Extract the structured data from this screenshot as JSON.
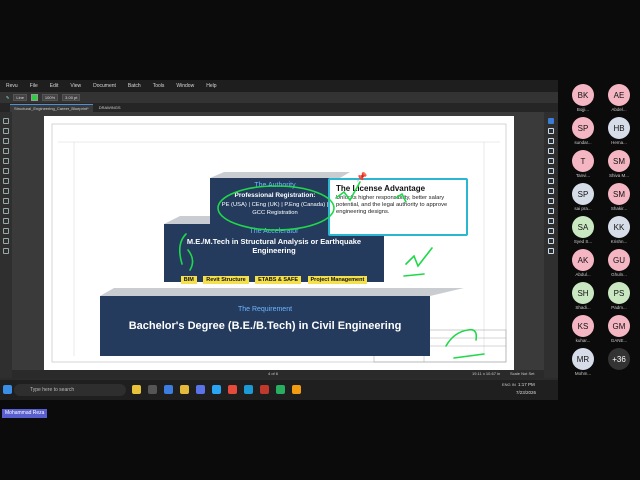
{
  "menu": [
    "Revu",
    "File",
    "Edit",
    "View",
    "Document",
    "Batch",
    "Tools",
    "Window",
    "Help"
  ],
  "toolbar": {
    "line_label": "Line",
    "zoom": "100%",
    "thickness": "3.00 pt"
  },
  "tabs": {
    "file": "Structural_Engineering_Career_Blueprint*",
    "drawings": "DRAWINGS"
  },
  "document": {
    "tier_top": {
      "heading": "The Authority",
      "title": "Professional Registration:",
      "body": "PE (USA) | CEng (UK) | P.Eng (Canada) | GCC Registration"
    },
    "tier_mid": {
      "heading": "The Accelerator",
      "title": "M.E./M.Tech in Structural Analysis or Earthquake Engineering",
      "tags": [
        "BIM",
        "Revit Structure",
        "ETABS & SAFE",
        "Project Management"
      ]
    },
    "tier_bottom": {
      "heading": "The Requirement",
      "title": "Bachelor's Degree (B.E./B.Tech) in Civil Engineering"
    },
    "callout": {
      "title": "The License Advantage",
      "body": "Unlocks higher responsibility, better salary potential, and the legal authority to approve engineering designs."
    }
  },
  "status": {
    "page": "4 of 6",
    "dims": "19.11 x 10.67 in",
    "scale": "Scale Not Set"
  },
  "taskbar": {
    "search_placeholder": "Type here to search",
    "time": "1:17 PM",
    "date": "7/23/2026",
    "lang": "ENG IN"
  },
  "participants": [
    {
      "initials": "BK",
      "name": "Bojji...",
      "color": "#f4b6c2"
    },
    {
      "initials": "AE",
      "name": "Abdel...",
      "color": "#f4b6c2"
    },
    {
      "initials": "SP",
      "name": "sundar...",
      "color": "#f4b6c2"
    },
    {
      "initials": "HB",
      "name": "Hema...",
      "color": "#d7dde8"
    },
    {
      "initials": "T",
      "name": "Tanvi...",
      "color": "#f4b6c2"
    },
    {
      "initials": "SM",
      "name": "Shiva M...",
      "color": "#f4b6c2"
    },
    {
      "initials": "SP",
      "name": "sai pra...",
      "color": "#d7dde8"
    },
    {
      "initials": "SM",
      "name": "Shakir...",
      "color": "#f4b6c2"
    },
    {
      "initials": "SA",
      "name": "Syed S...",
      "color": "#c9e7c1"
    },
    {
      "initials": "KK",
      "name": "Krishn...",
      "color": "#d7dde8"
    },
    {
      "initials": "AK",
      "name": "Abdul...",
      "color": "#f4b6c2"
    },
    {
      "initials": "GU",
      "name": "Ghuln...",
      "color": "#f4b6c2"
    },
    {
      "initials": "SH",
      "name": "Shadi...",
      "color": "#c9e7c1"
    },
    {
      "initials": "PS",
      "name": "Padm...",
      "color": "#c9e7c1"
    },
    {
      "initials": "KS",
      "name": "kuhar...",
      "color": "#f4b6c2"
    },
    {
      "initials": "GM",
      "name": "GANE...",
      "color": "#f4b6c2"
    },
    {
      "initials": "MR",
      "name": "Mohm...",
      "color": "#d7dde8"
    }
  ],
  "participants_more": "+36",
  "presenter": "Mohammad Reza"
}
